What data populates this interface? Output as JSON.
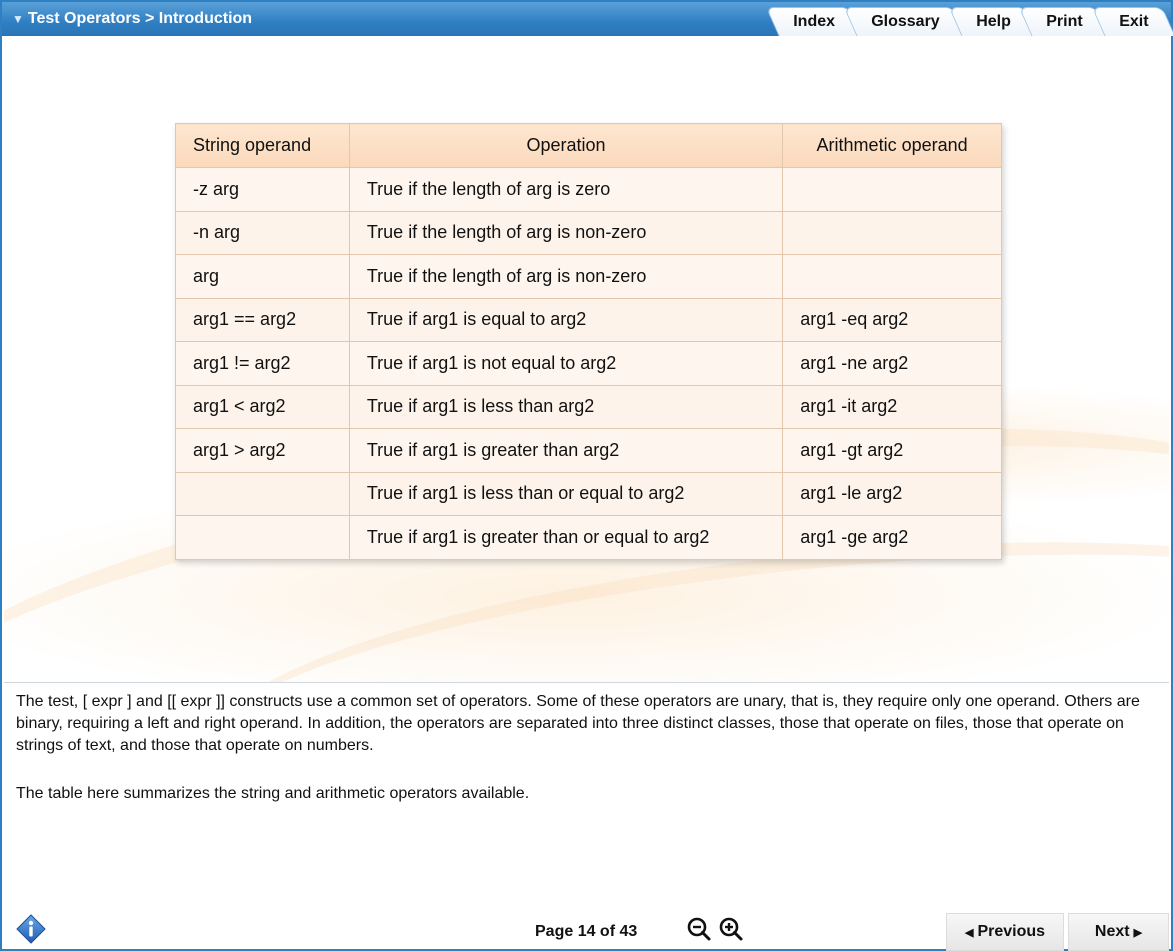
{
  "header": {
    "breadcrumb": "Test Operators > Introduction",
    "tabs": [
      "Index",
      "Glossary",
      "Help",
      "Print",
      "Exit"
    ]
  },
  "table": {
    "headers": [
      "String operand",
      "Operation",
      "Arithmetic operand"
    ],
    "rows": [
      [
        "-z arg",
        "True if the length of arg is zero",
        ""
      ],
      [
        "-n arg",
        "True if the length of arg is non-zero",
        ""
      ],
      [
        "arg",
        "True if the length of arg is non-zero",
        ""
      ],
      [
        "arg1 == arg2",
        "True if arg1 is equal to arg2",
        "arg1 -eq arg2"
      ],
      [
        "arg1 != arg2",
        "True if arg1 is not equal to arg2",
        "arg1 -ne arg2"
      ],
      [
        "arg1 < arg2",
        "True if arg1 is less than arg2",
        "arg1 -it arg2"
      ],
      [
        "arg1 > arg2",
        "True if arg1 is greater than arg2",
        "arg1 -gt arg2"
      ],
      [
        "",
        "True if arg1 is less than or equal to arg2",
        "arg1 -le arg2"
      ],
      [
        "",
        "True if arg1 is greater than or equal to arg2",
        "arg1 -ge arg2"
      ]
    ]
  },
  "body": {
    "paragraph1": "The test, [ expr ] and [[ expr ]] constructs use a common set of operators. Some of these operators are unary, that is, they require only one operand. Others are binary, requiring a left and right operand. In addition, the operators are separated into three distinct classes, those that operate on files, those that operate on strings of text, and those that operate on numbers.",
    "paragraph2": "The table here summarizes the string and arithmetic operators available."
  },
  "footer": {
    "page_label": "Page 14 of 43",
    "previous_label": "Previous",
    "next_label": "Next"
  },
  "icons": {
    "info": "info-icon",
    "zoom_out": "zoom-out-icon",
    "zoom_in": "zoom-in-icon"
  },
  "colors": {
    "accent": "#2f7fc3",
    "table_header": "#fbdcc0",
    "table_cell": "#fdf3ea",
    "table_border": "#e3c7ad",
    "info_icon": "#2f6ec0"
  }
}
